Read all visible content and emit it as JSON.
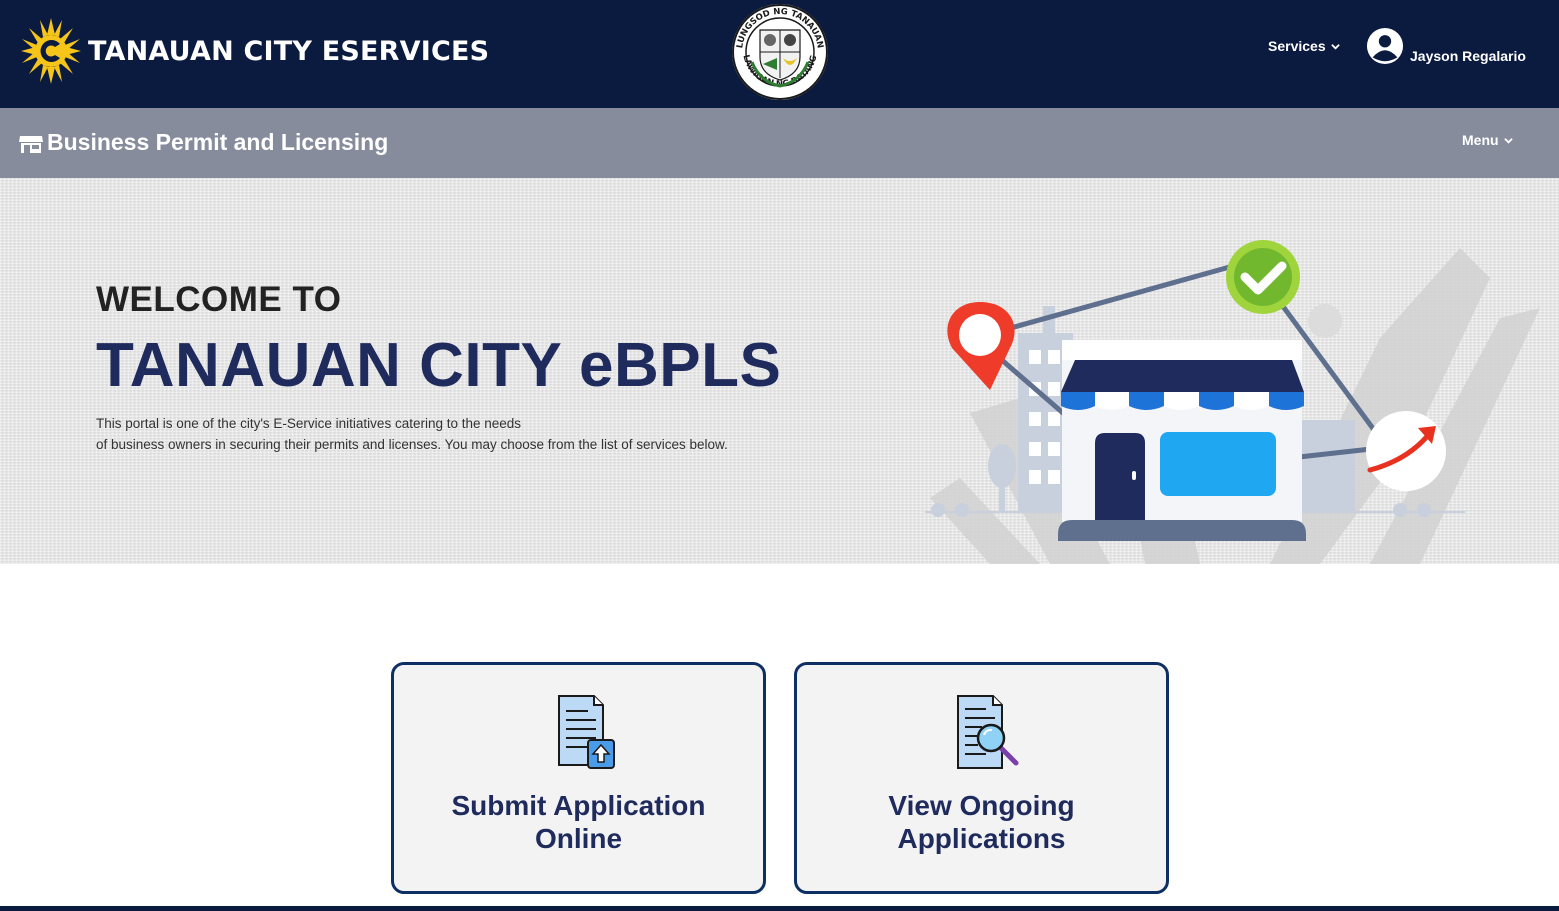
{
  "header": {
    "brand_title": "TANAUAN CITY ESERVICES",
    "seal_text_top": "LUNGSOD NG TANAUAN",
    "seal_text_bottom": "LALAWIGAN NG BATANGAS",
    "services_label": "Services",
    "user_name": "Jayson Regalario"
  },
  "subheader": {
    "module_title": "Business Permit and Licensing",
    "menu_label": "Menu"
  },
  "hero": {
    "welcome": "WELCOME TO",
    "title": "TANAUAN CITY eBPLS",
    "description_line1": "This portal is one of the city's E-Service initiatives catering to the needs",
    "description_line2": "of business owners in securing their permits and licenses. You may choose from the list of services below."
  },
  "cards": [
    {
      "line1": "Submit Application",
      "line2": "Online",
      "icon": "document-upload-icon"
    },
    {
      "line1": "View Ongoing",
      "line2": "Applications",
      "icon": "document-search-icon"
    }
  ],
  "colors": {
    "header_bg": "#0b1a3f",
    "subheader_bg": "#878c9c",
    "accent_navy": "#1f2b5c",
    "card_border": "#0e2f63",
    "sun_yellow": "#f6c519"
  }
}
